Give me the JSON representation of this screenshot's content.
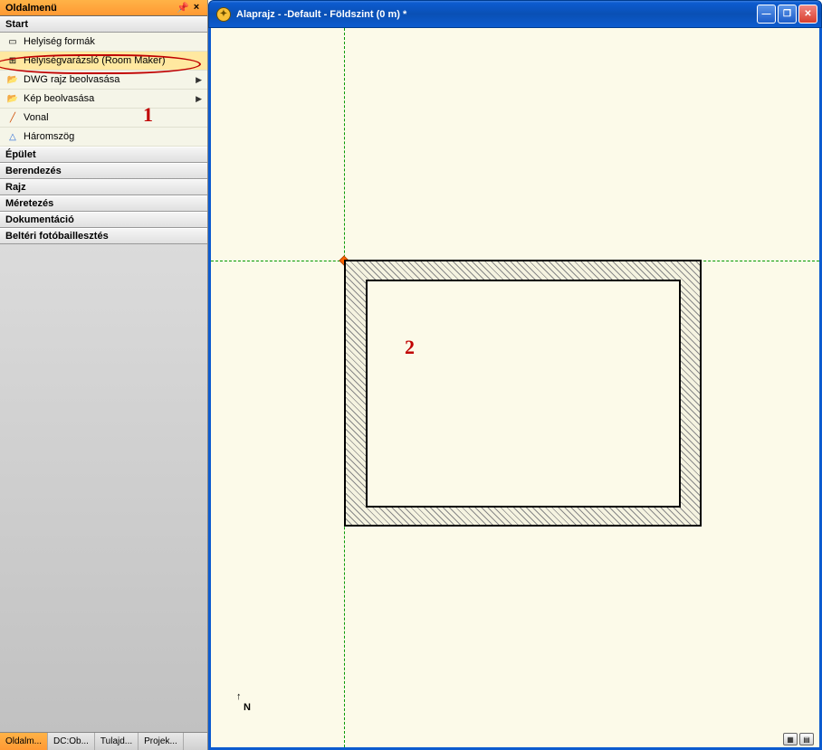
{
  "sidebar": {
    "title": "Oldalmenü",
    "sections": [
      {
        "header": "Start",
        "expanded": true,
        "items": [
          {
            "label": "Helyiség formák",
            "icon": "▭",
            "has_submenu": false
          },
          {
            "label": "Helyiségvarázsló (Room Maker)",
            "icon": "⊞",
            "has_submenu": false,
            "highlighted": true
          },
          {
            "label": "DWG rajz beolvasása",
            "icon": "📂",
            "has_submenu": true
          },
          {
            "label": "Kép beolvasása",
            "icon": "📂",
            "has_submenu": true
          },
          {
            "label": "Vonal",
            "icon": "╱",
            "has_submenu": false
          },
          {
            "label": "Háromszög",
            "icon": "△",
            "has_submenu": false
          }
        ]
      },
      {
        "header": "Épület",
        "expanded": false
      },
      {
        "header": "Berendezés",
        "expanded": false
      },
      {
        "header": "Rajz",
        "expanded": false
      },
      {
        "header": "Méretezés",
        "expanded": false
      },
      {
        "header": "Dokumentáció",
        "expanded": false
      },
      {
        "header": "Beltéri fotóbaillesztés",
        "expanded": false
      }
    ],
    "bottom_tabs": [
      "Oldalm...",
      "DC:Ob...",
      "Tulajd...",
      "Projek..."
    ],
    "pin_symbol": "📌",
    "close_symbol": "×"
  },
  "window": {
    "title": "Alaprajz - -Default - Földszint (0 m) *",
    "min_symbol": "—",
    "max_symbol": "❐",
    "close_symbol": "✕"
  },
  "annotations": {
    "num1": "1",
    "num2": "2"
  },
  "north_label": "N",
  "north_arrow": "↑"
}
